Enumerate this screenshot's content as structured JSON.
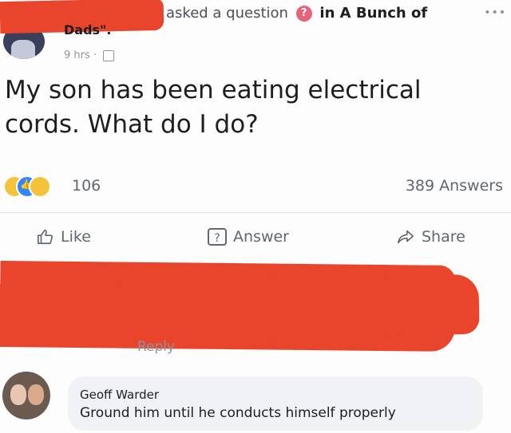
{
  "post": {
    "header": {
      "action_text": "asked a question",
      "question_badge": "?",
      "in_text": "in A Bunch of",
      "author_tail": "Dads\".",
      "timestamp": "9 hrs ·",
      "more": "•••"
    },
    "question": "My son has been eating electrical cords. What do I do?",
    "stats": {
      "reaction_count": "106",
      "answers": "389 Answers",
      "reactions": [
        "haha",
        "like",
        "wow"
      ]
    },
    "actions": {
      "like": "Like",
      "answer": "Answer",
      "answer_icon": "?",
      "share": "Share"
    }
  },
  "comments": {
    "reply_tail": "Reply",
    "items": [
      {
        "name": "Geoff Warder",
        "text": "Ground him until he conducts himself properly"
      }
    ]
  },
  "colors": {
    "redaction": "#e8452c",
    "badge": "#e8627a",
    "like_reaction": "#2d88ff",
    "haha_reaction": "#f5c33b"
  }
}
